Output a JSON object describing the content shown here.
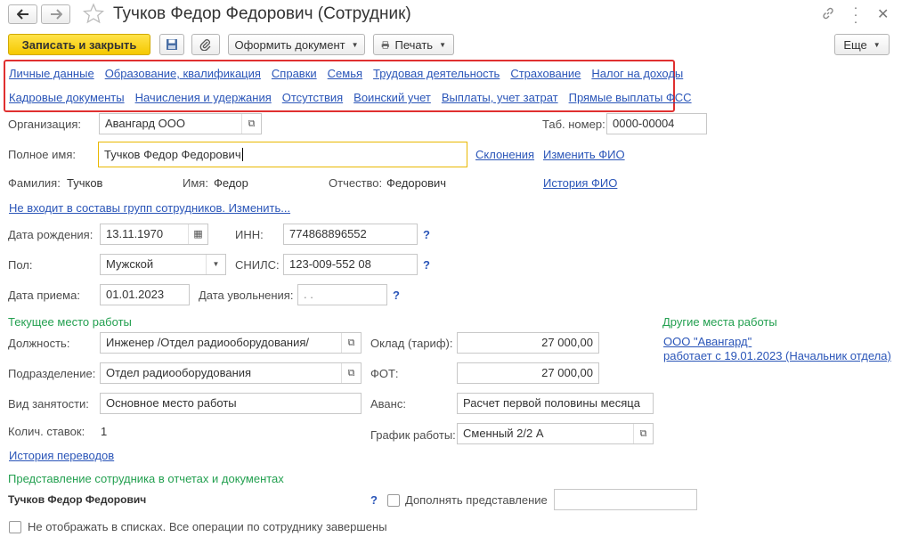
{
  "window": {
    "title": "Тучков Федор Федорович (Сотрудник)",
    "icons": [
      "arrow-left-icon",
      "arrow-right-icon",
      "star-icon",
      "link-icon",
      "more-icon",
      "close-icon"
    ]
  },
  "toolbar": {
    "save_close": "Записать и закрыть",
    "issue_document": "Оформить документ",
    "print": "Печать",
    "more": "Еще"
  },
  "nav_links": {
    "row1": [
      "Личные данные",
      "Образование, квалификация",
      "Справки",
      "Семья",
      "Трудовая деятельность",
      "Страхование",
      "Налог на доходы"
    ],
    "row2": [
      "Кадровые документы",
      "Начисления и удержания",
      "Отсутствия",
      "Воинский учет",
      "Выплаты, учет затрат",
      "Прямые выплаты ФСС"
    ]
  },
  "colors": {
    "highlight_border": "#e03030",
    "link": "#2a55b8",
    "section": "#23a050",
    "primary_button": "#f5c800"
  },
  "org": {
    "label": "Организация:",
    "value": "Авангард ООО"
  },
  "tab_number": {
    "label": "Таб. номер:",
    "value": "0000-00004"
  },
  "full_name": {
    "label": "Полное имя:",
    "value": "Тучков Федор Федорович",
    "declensions": "Склонения",
    "change_fio": "Изменить ФИО"
  },
  "name_parts": {
    "last_label": "Фамилия:",
    "last_value": "Тучков",
    "first_label": "Имя:",
    "first_value": "Федор",
    "middle_label": "Отчество:",
    "middle_value": "Федорович",
    "fio_history": "История ФИО"
  },
  "groups_link": "Не входит в составы групп сотрудников. Изменить...",
  "birth_date": {
    "label": "Дата рождения:",
    "value": "13.11.1970"
  },
  "inn": {
    "label": "ИНН:",
    "value": "774868896552"
  },
  "gender": {
    "label": "Пол:",
    "value": "Мужской"
  },
  "snils": {
    "label": "СНИЛС:",
    "value": "123-009-552 08"
  },
  "hire_date": {
    "label": "Дата приема:",
    "value": "01.01.2023"
  },
  "dismissal": {
    "label": "Дата увольнения:",
    "value": " .  ."
  },
  "help_mark": "?",
  "current_work": {
    "title": "Текущее место работы",
    "position_label": "Должность:",
    "position_value": "Инженер /Отдел радиооборудования/",
    "department_label": "Подразделение:",
    "department_value": "Отдел радиооборудования",
    "employment_label": "Вид занятости:",
    "employment_value": "Основное место работы",
    "rates_label": "Колич. ставок:",
    "rates_value": "1",
    "salary_label": "Оклад (тариф):",
    "salary_value": "27 000,00",
    "fot_label": "ФОТ:",
    "fot_value": "27 000,00",
    "advance_label": "Аванс:",
    "advance_value": "Расчет первой половины месяца",
    "schedule_label": "График работы:",
    "schedule_value": "Сменный 2/2 А",
    "transfer_history": "История переводов"
  },
  "other_work": {
    "title": "Другие места работы",
    "org_link": "ООО \"Авангард\"",
    "works_since": "работает с 19.01.2023 (Начальник отдела)"
  },
  "representation": {
    "title": "Представление сотрудника в отчетах и документах",
    "value": "Тучков Федор Федорович",
    "supplement_label": "Дополнять представление",
    "supplement_value": ""
  },
  "hide_in_lists": "Не отображать в списках. Все операции по сотруднику завершены"
}
